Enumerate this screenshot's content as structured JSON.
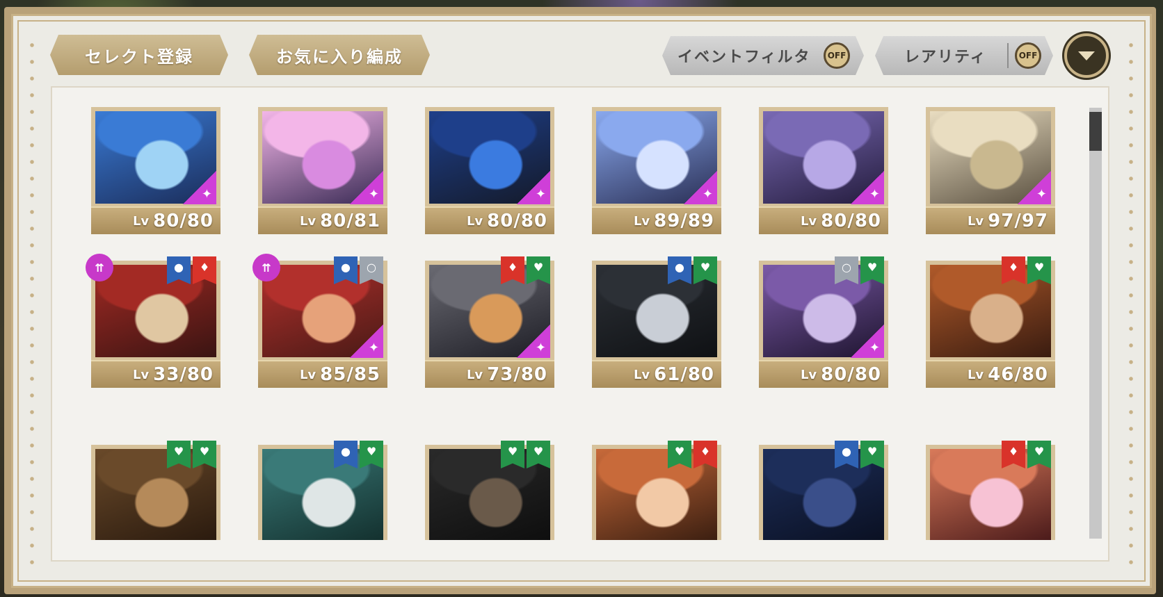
{
  "toolbar": {
    "select_register": "セレクト登録",
    "favorite_formation": "お気に入り編成",
    "event_filter": "イベントフィルタ",
    "event_filter_state": "OFF",
    "rarity": "レアリティ",
    "rarity_state": "OFF"
  },
  "level_prefix": "Lv",
  "cards": [
    {
      "level": "80/80",
      "sparkle": true,
      "up": false,
      "ribbons": [],
      "palette": [
        "#3a7bd5",
        "#9fd3f5",
        "#1b2d5a"
      ]
    },
    {
      "level": "80/81",
      "sparkle": true,
      "up": false,
      "ribbons": [],
      "palette": [
        "#f3b6e8",
        "#d98be0",
        "#3a2b55"
      ]
    },
    {
      "level": "80/80",
      "sparkle": true,
      "up": false,
      "ribbons": [],
      "palette": [
        "#1e3f8a",
        "#3b7be0",
        "#141a2a"
      ]
    },
    {
      "level": "89/89",
      "sparkle": true,
      "up": false,
      "ribbons": [],
      "palette": [
        "#8aa9ee",
        "#d6e2ff",
        "#2a2f55"
      ]
    },
    {
      "level": "80/80",
      "sparkle": true,
      "up": false,
      "ribbons": [],
      "palette": [
        "#7a6ab5",
        "#b7a8e6",
        "#241c3d"
      ]
    },
    {
      "level": "97/97",
      "sparkle": true,
      "up": false,
      "ribbons": [],
      "palette": [
        "#e9ddc1",
        "#c9b88f",
        "#5a5040"
      ]
    },
    {
      "level": "33/80",
      "sparkle": false,
      "up": true,
      "ribbons": [
        "blue",
        "red"
      ],
      "palette": [
        "#a32a24",
        "#e0c7a2",
        "#3a1412"
      ]
    },
    {
      "level": "85/85",
      "sparkle": true,
      "up": true,
      "ribbons": [
        "blue",
        "gray"
      ],
      "palette": [
        "#b2302c",
        "#e6a27a",
        "#4a1a16"
      ]
    },
    {
      "level": "73/80",
      "sparkle": true,
      "up": false,
      "ribbons": [
        "red",
        "green"
      ],
      "palette": [
        "#6a6a72",
        "#d99a5a",
        "#1e1e26"
      ]
    },
    {
      "level": "61/80",
      "sparkle": false,
      "up": false,
      "ribbons": [
        "blue",
        "green"
      ],
      "palette": [
        "#2c3036",
        "#c9ced6",
        "#0f1114"
      ]
    },
    {
      "level": "80/80",
      "sparkle": true,
      "up": false,
      "ribbons": [
        "gray",
        "green"
      ],
      "palette": [
        "#7b5aa8",
        "#cdbbe8",
        "#1f1530"
      ]
    },
    {
      "level": "46/80",
      "sparkle": false,
      "up": false,
      "ribbons": [
        "red",
        "green"
      ],
      "palette": [
        "#b05a2a",
        "#d9b08a",
        "#3a1c10"
      ]
    },
    {
      "level": "",
      "sparkle": false,
      "up": false,
      "ribbons": [
        "green",
        "green"
      ],
      "palette": [
        "#6a4a2a",
        "#b58a5a",
        "#2a1a0e"
      ]
    },
    {
      "level": "",
      "sparkle": false,
      "up": false,
      "ribbons": [
        "blue",
        "green"
      ],
      "palette": [
        "#3a7a78",
        "#dfe6e6",
        "#13302e"
      ]
    },
    {
      "level": "",
      "sparkle": false,
      "up": false,
      "ribbons": [
        "green",
        "green"
      ],
      "palette": [
        "#2a2a2a",
        "#6a5a4a",
        "#0e0e0e"
      ]
    },
    {
      "level": "",
      "sparkle": false,
      "up": false,
      "ribbons": [
        "green",
        "red"
      ],
      "palette": [
        "#c86a3a",
        "#f2c9a6",
        "#3a1e10"
      ]
    },
    {
      "level": "",
      "sparkle": false,
      "up": false,
      "ribbons": [
        "blue",
        "green"
      ],
      "palette": [
        "#1d2e5a",
        "#3a4f8a",
        "#0a1022"
      ]
    },
    {
      "level": "",
      "sparkle": false,
      "up": false,
      "ribbons": [
        "red",
        "green"
      ],
      "palette": [
        "#d97a5a",
        "#f7c2d4",
        "#4a1a1a"
      ]
    }
  ]
}
